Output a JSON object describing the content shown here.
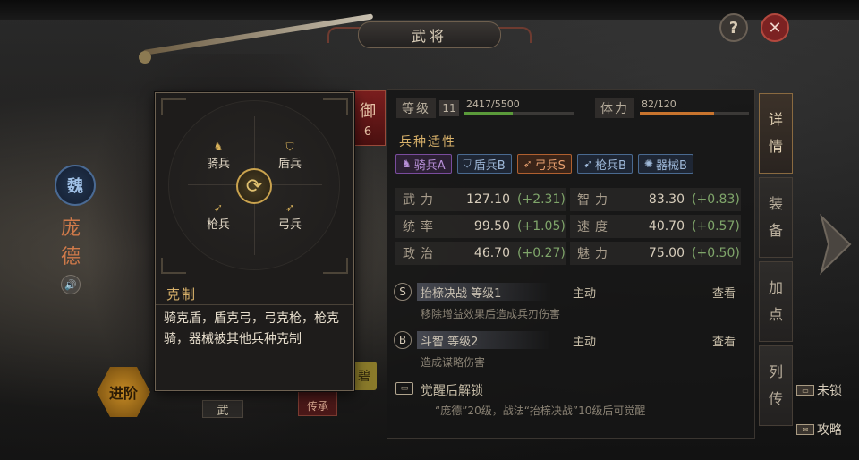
{
  "window": {
    "title": "武将"
  },
  "header": {
    "help_label": "?",
    "close_label": "✕"
  },
  "hero": {
    "faction": "魏",
    "name_chars": [
      "庞",
      "德"
    ],
    "voice_icon": "speaker-icon",
    "advance_label": "进阶",
    "defense": {
      "label": "御",
      "value": "6"
    },
    "tab_wu": "武",
    "chuan_label": "传承",
    "gold_tag": "碧"
  },
  "level": {
    "label": "等级",
    "value": "11",
    "exp_text": "2417/5500",
    "exp_fraction": 0.44
  },
  "stamina": {
    "label": "体力",
    "value_text": "82/120",
    "fraction": 0.683
  },
  "aptitude": {
    "title": "兵种适性",
    "items": [
      {
        "icon": "horse-icon",
        "glyph": "♞",
        "label": "骑兵A",
        "color": "#b78fd8",
        "border": "#7a4c9e",
        "bg": "#2c2034"
      },
      {
        "icon": "shield-icon",
        "glyph": "⛉",
        "label": "盾兵B",
        "color": "#9eb8d8",
        "border": "#4a6a90",
        "bg": "#1e2634"
      },
      {
        "icon": "bow-icon",
        "glyph": "➶",
        "label": "弓兵S",
        "color": "#e8a070",
        "border": "#b06030",
        "bg": "#3a2418"
      },
      {
        "icon": "spear-icon",
        "glyph": "➹",
        "label": "枪兵B",
        "color": "#9eb8d8",
        "border": "#4a6a90",
        "bg": "#1e2634"
      },
      {
        "icon": "siege-icon",
        "glyph": "✺",
        "label": "器械B",
        "color": "#9eb8d8",
        "border": "#4a6a90",
        "bg": "#1e2634"
      }
    ]
  },
  "stats": [
    {
      "name": "武力",
      "value": "127.10",
      "bonus": "(+2.31)"
    },
    {
      "name": "智力",
      "value": "83.30",
      "bonus": "(+0.83)"
    },
    {
      "name": "统率",
      "value": "99.50",
      "bonus": "(+1.05)"
    },
    {
      "name": "速度",
      "value": "40.70",
      "bonus": "(+0.57)"
    },
    {
      "name": "政治",
      "value": "46.70",
      "bonus": "(+0.27)"
    },
    {
      "name": "魅力",
      "value": "75.00",
      "bonus": "(+0.50)"
    }
  ],
  "skills": [
    {
      "letter": "S",
      "name": "抬榇决战 等级1",
      "type": "主动",
      "view": "查看",
      "desc": "移除增益效果后造成兵刃伤害"
    },
    {
      "letter": "B",
      "name": "斗智 等级2",
      "type": "主动",
      "view": "查看",
      "desc": "造成谋略伤害"
    }
  ],
  "awaken": {
    "icon": "lock-icon",
    "title": "觉醒后解锁",
    "desc": "“庞德”20级，战法“抬榇决战”10级后可觉醒"
  },
  "side_tabs": [
    {
      "label": "详情",
      "active": true
    },
    {
      "label": "装备",
      "active": false
    },
    {
      "label": "加点",
      "active": false
    },
    {
      "label": "列传",
      "active": false
    }
  ],
  "corner_links": [
    {
      "label": "未锁",
      "icon": "lock-icon"
    },
    {
      "label": "攻略",
      "icon": "scroll-icon"
    }
  ],
  "popup": {
    "units": [
      {
        "icon": "horse-icon",
        "glyph": "♞",
        "label": "骑兵"
      },
      {
        "icon": "shield-icon",
        "glyph": "⛉",
        "label": "盾兵"
      },
      {
        "icon": "spear-icon",
        "glyph": "➹",
        "label": "枪兵"
      },
      {
        "icon": "bow-icon",
        "glyph": "➶",
        "label": "弓兵"
      }
    ],
    "cycle_icon": "cycle-icon",
    "title": "克制",
    "desc": "骑克盾，盾克弓，弓克枪，枪克骑，器械被其他兵种克制"
  },
  "colors": {
    "exp_bar": "#5a9a3a",
    "stamina_bar": "#c8742e",
    "accent_gold": "#d8b16a"
  }
}
